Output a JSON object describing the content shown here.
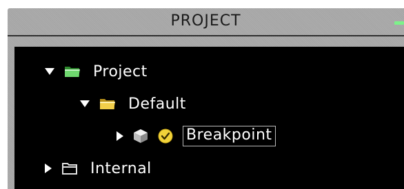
{
  "panel": {
    "title": "PROJECT"
  },
  "tree": {
    "items": [
      {
        "label": "Project",
        "expanded": true,
        "icon": "folder-open-icon"
      },
      {
        "label": "Default",
        "expanded": true,
        "icon": "folder-open-icon"
      },
      {
        "label": "Breakpoint",
        "expanded": false,
        "checked": true,
        "selected": true,
        "icon": "cube-icon"
      },
      {
        "label": "Internal",
        "expanded": false,
        "icon": "folder-closed-icon"
      }
    ]
  },
  "colors": {
    "panel_background": "#a9a9a9",
    "tree_background": "#000000",
    "folder": "#4ec94e",
    "checkbox": "#f2d33a",
    "minimize": "#7df28a"
  }
}
